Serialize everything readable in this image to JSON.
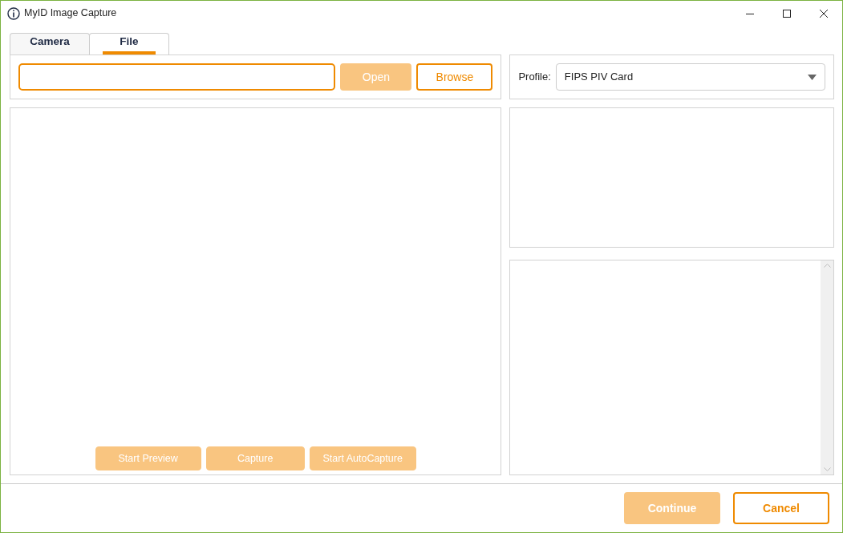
{
  "window": {
    "title": "MyID Image Capture"
  },
  "tabs": [
    {
      "label": "Camera",
      "selected": false
    },
    {
      "label": "File",
      "selected": true
    }
  ],
  "file_bar": {
    "buttons": [
      {
        "label": "Open",
        "disabled": true
      },
      {
        "label": "Browse",
        "disabled": false
      }
    ]
  },
  "preview_buttons": [
    {
      "label": "Start Preview",
      "disabled": true
    },
    {
      "label": "Capture",
      "disabled": true
    },
    {
      "label": "Start AutoCapture",
      "disabled": true
    }
  ],
  "profile": {
    "label": "Profile:",
    "value": "FIPS PIV Card"
  },
  "footer_buttons": [
    {
      "label": "Continue",
      "disabled": true
    },
    {
      "label": "Cancel",
      "disabled": false
    }
  ]
}
